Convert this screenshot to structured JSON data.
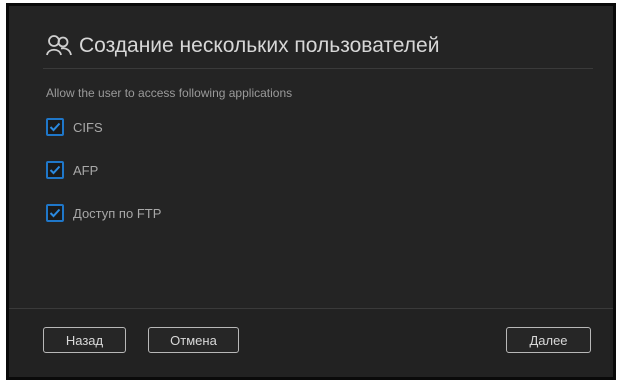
{
  "dialog": {
    "title": "Создание нескольких пользователей",
    "title_icon": "users-icon",
    "subtitle": "Allow the user to access following applications",
    "applications": [
      {
        "label": "CIFS",
        "checked": true
      },
      {
        "label": "AFP",
        "checked": true
      },
      {
        "label": "Доступ по FTP",
        "checked": true
      }
    ],
    "buttons": {
      "back": "Назад",
      "cancel": "Отмена",
      "next": "Далее"
    }
  },
  "colors": {
    "background": "#242424",
    "accent": "#1f77c9",
    "text": "#d7d7d7"
  }
}
